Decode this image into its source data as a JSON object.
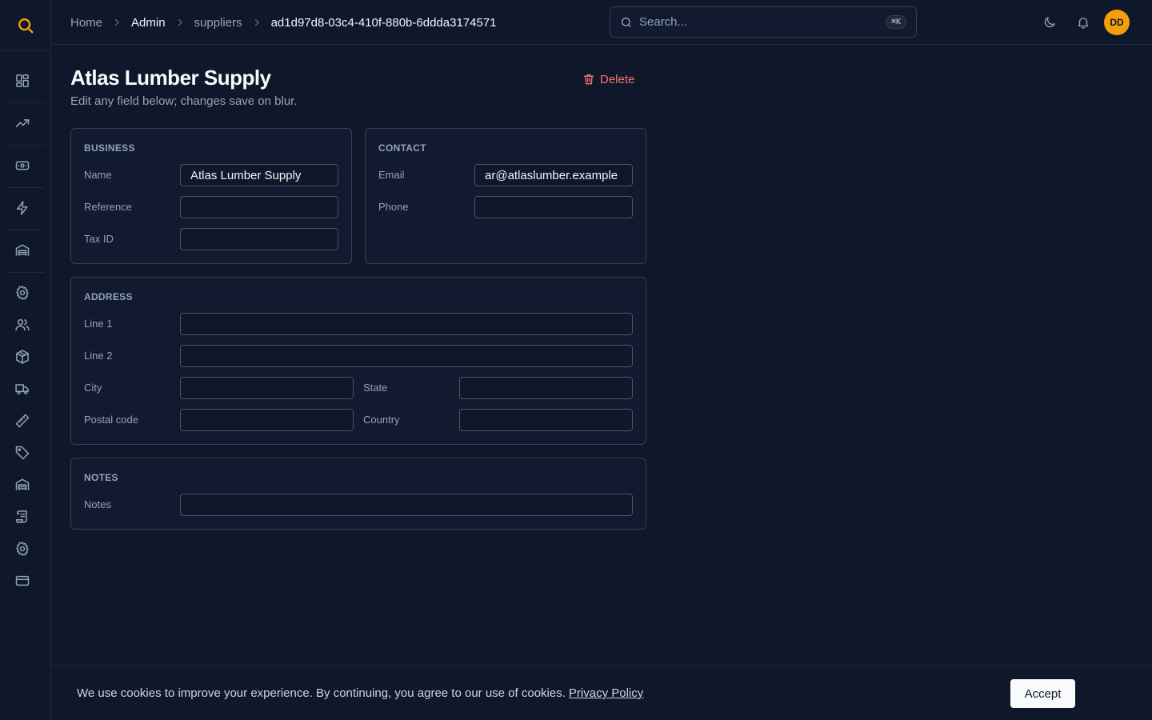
{
  "colors": {
    "accent": "#f59e0b",
    "danger": "#f87171",
    "background": "#0f172a",
    "card": "#111a2e"
  },
  "sidebar": {
    "logo_icon": "search-logo-icon",
    "items": [
      {
        "name": "dashboard",
        "icon": "grid-icon"
      },
      {
        "name": "analytics",
        "icon": "trending-up-icon"
      },
      {
        "name": "finance",
        "icon": "banknote-icon"
      },
      {
        "name": "automation",
        "icon": "lightning-icon"
      },
      {
        "name": "warehouse",
        "icon": "warehouse-icon"
      },
      {
        "name": "settings",
        "icon": "gear-icon"
      },
      {
        "name": "users",
        "icon": "users-icon"
      },
      {
        "name": "products",
        "icon": "package-icon"
      },
      {
        "name": "shipping",
        "icon": "truck-icon"
      },
      {
        "name": "measure",
        "icon": "ruler-icon"
      },
      {
        "name": "tags",
        "icon": "tag-icon"
      },
      {
        "name": "warehouses",
        "icon": "warehouse-icon"
      },
      {
        "name": "logs",
        "icon": "scroll-icon"
      },
      {
        "name": "admin-settings",
        "icon": "gear-icon"
      },
      {
        "name": "billing",
        "icon": "credit-card-icon"
      }
    ]
  },
  "header": {
    "breadcrumb": [
      "Home",
      "Admin",
      "suppliers",
      "ad1d97d8-03c4-410f-880b-6ddda3174571"
    ],
    "search_placeholder": "Search...",
    "search_shortcut": "⌘K",
    "avatar_initials": "DD"
  },
  "page": {
    "title": "Atlas Lumber Supply",
    "subtitle": "Edit any field below; changes save on blur.",
    "delete_label": "Delete"
  },
  "business": {
    "title": "BUSINESS",
    "name_label": "Name",
    "name_value": "Atlas Lumber Supply",
    "reference_label": "Reference",
    "reference_value": "",
    "taxid_label": "Tax ID",
    "taxid_value": ""
  },
  "contact": {
    "title": "CONTACT",
    "email_label": "Email",
    "email_value": "ar@atlaslumber.example",
    "phone_label": "Phone",
    "phone_value": ""
  },
  "address": {
    "title": "ADDRESS",
    "line1_label": "Line 1",
    "line2_label": "Line 2",
    "city_label": "City",
    "state_label": "State",
    "postal_label": "Postal code",
    "country_label": "Country"
  },
  "notes": {
    "title": "NOTES",
    "notes_label": "Notes",
    "notes_value": ""
  },
  "cookie": {
    "text": "We use cookies to improve your experience. By continuing, you agree to our use of cookies.",
    "link": "Privacy Policy",
    "accept": "Accept"
  }
}
